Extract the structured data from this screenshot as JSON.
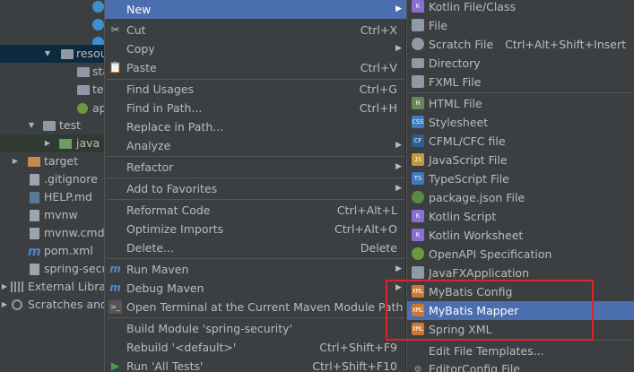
{
  "tree": {
    "items": [
      {
        "label": "",
        "icon": "class-icon"
      },
      {
        "label": "",
        "icon": "class-icon"
      },
      {
        "label": "",
        "icon": "class-icon"
      },
      {
        "label": "resou",
        "icon": "folder-icon"
      },
      {
        "label": "sta",
        "icon": "folder-icon"
      },
      {
        "label": "te",
        "icon": "folder-icon"
      },
      {
        "label": "ap",
        "icon": "config-icon"
      },
      {
        "label": "test",
        "icon": "folder-icon"
      },
      {
        "label": "java",
        "icon": "folder-icon"
      },
      {
        "label": "target",
        "icon": "folder-icon"
      },
      {
        "label": ".gitignore",
        "icon": "file-icon"
      },
      {
        "label": "HELP.md",
        "icon": "markdown-icon"
      },
      {
        "label": "mvnw",
        "icon": "file-icon"
      },
      {
        "label": "mvnw.cmd",
        "icon": "file-icon"
      },
      {
        "label": "pom.xml",
        "icon": "maven-icon"
      },
      {
        "label": "spring-secu",
        "icon": "file-icon"
      },
      {
        "label": "External Librar",
        "icon": "library-icon"
      },
      {
        "label": "Scratches and",
        "icon": "scratch-icon"
      }
    ]
  },
  "context_menu": {
    "items": [
      {
        "label": "New",
        "shortcut": "",
        "submenu": true
      },
      {
        "label": "Cut",
        "shortcut": "Ctrl+X",
        "submenu": false,
        "icon": "scissors-icon"
      },
      {
        "label": "Copy",
        "shortcut": "",
        "submenu": true
      },
      {
        "label": "Paste",
        "shortcut": "Ctrl+V",
        "submenu": false,
        "icon": "clipboard-icon"
      },
      {
        "label": "Find Usages",
        "shortcut": "Ctrl+G",
        "submenu": false
      },
      {
        "label": "Find in Path...",
        "shortcut": "Ctrl+H",
        "submenu": false
      },
      {
        "label": "Replace in Path...",
        "shortcut": "",
        "submenu": false
      },
      {
        "label": "Analyze",
        "shortcut": "",
        "submenu": true
      },
      {
        "label": "Refactor",
        "shortcut": "",
        "submenu": true
      },
      {
        "label": "Add to Favorites",
        "shortcut": "",
        "submenu": true
      },
      {
        "label": "Reformat Code",
        "shortcut": "Ctrl+Alt+L",
        "submenu": false
      },
      {
        "label": "Optimize Imports",
        "shortcut": "Ctrl+Alt+O",
        "submenu": false
      },
      {
        "label": "Delete...",
        "shortcut": "Delete",
        "submenu": false
      },
      {
        "label": "Run Maven",
        "shortcut": "",
        "submenu": true,
        "icon": "maven-icon"
      },
      {
        "label": "Debug Maven",
        "shortcut": "",
        "submenu": true,
        "icon": "maven-icon"
      },
      {
        "label": "Open Terminal at the Current Maven Module Path",
        "shortcut": "",
        "submenu": false,
        "icon": "terminal-icon"
      },
      {
        "label": "Build Module 'spring-security'",
        "shortcut": "",
        "submenu": false
      },
      {
        "label": "Rebuild '<default>'",
        "shortcut": "Ctrl+Shift+F9",
        "submenu": false
      },
      {
        "label": "Run 'All Tests'",
        "shortcut": "Ctrl+Shift+F10",
        "submenu": false,
        "icon": "run-icon"
      }
    ]
  },
  "new_submenu": {
    "items": [
      {
        "label": "Kotlin File/Class",
        "shortcut": "",
        "icon": "kotlin-icon",
        "color": "#8a6fd1"
      },
      {
        "label": "File",
        "shortcut": "",
        "icon": "file-icon",
        "color": "#8f9aa6"
      },
      {
        "label": "Scratch File",
        "shortcut": "Ctrl+Alt+Shift+Insert",
        "icon": "scratch-icon",
        "color": "#8f9aa6"
      },
      {
        "label": "Directory",
        "shortcut": "",
        "icon": "folder-icon",
        "color": "#8f9aa6"
      },
      {
        "label": "FXML File",
        "shortcut": "",
        "icon": "fxml-icon",
        "color": "#8f9aa6"
      },
      {
        "label": "HTML File",
        "shortcut": "",
        "icon": "html-icon",
        "color": "#6a8759"
      },
      {
        "label": "Stylesheet",
        "shortcut": "",
        "icon": "css-icon",
        "color": "#3d7bbf"
      },
      {
        "label": "CFML/CFC file",
        "shortcut": "",
        "icon": "cfml-icon",
        "color": "#2d5f92"
      },
      {
        "label": "JavaScript File",
        "shortcut": "",
        "icon": "javascript-icon",
        "color": "#c29a3c"
      },
      {
        "label": "TypeScript File",
        "shortcut": "",
        "icon": "typescript-icon",
        "color": "#3d7bbf"
      },
      {
        "label": "package.json File",
        "shortcut": "",
        "icon": "npm-icon",
        "color": "#5a8a45"
      },
      {
        "label": "Kotlin Script",
        "shortcut": "",
        "icon": "kotlin-icon",
        "color": "#8a6fd1"
      },
      {
        "label": "Kotlin Worksheet",
        "shortcut": "",
        "icon": "kotlin-icon",
        "color": "#8a6fd1"
      },
      {
        "label": "OpenAPI Specification",
        "shortcut": "",
        "icon": "openapi-icon",
        "color": "#6a9a3a"
      },
      {
        "label": "JavaFXApplication",
        "shortcut": "",
        "icon": "javafx-icon",
        "color": "#8f9aa6"
      },
      {
        "label": "MyBatis Config",
        "shortcut": "",
        "icon": "mybatis-icon",
        "color": "#cc7832"
      },
      {
        "label": "MyBatis Mapper",
        "shortcut": "",
        "icon": "mybatis-icon",
        "color": "#cc7832"
      },
      {
        "label": "Spring XML",
        "shortcut": "",
        "icon": "xml-icon",
        "color": "#cc7832"
      },
      {
        "label": "Edit File Templates...",
        "shortcut": "",
        "icon": "",
        "color": ""
      },
      {
        "label": "EditorConfig File",
        "shortcut": "",
        "icon": "gear-icon",
        "color": "#8f9aa6"
      }
    ]
  },
  "colors": {
    "selection": "#4b6eaf",
    "highlight_box": "#e0202a",
    "background": "#3c3f41"
  }
}
